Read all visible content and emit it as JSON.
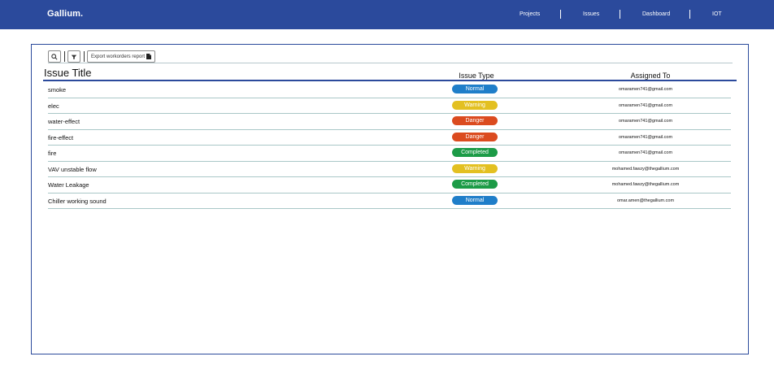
{
  "navbar": {
    "brand": "Gallium.",
    "items": [
      "Projects",
      "Issues",
      "Dashboard",
      "IOT"
    ]
  },
  "toolbar": {
    "export_label": "Export workorders report"
  },
  "table": {
    "headers": {
      "title": "Issue Title",
      "type": "Issue Type",
      "assigned": "Assigned To"
    },
    "rows": [
      {
        "title": "smoke",
        "type": "Normal",
        "assigned": "omaramen741@gmail.com"
      },
      {
        "title": "elec",
        "type": "Warning",
        "assigned": "omaramen741@gmail.com"
      },
      {
        "title": "water-effect",
        "type": "Danger",
        "assigned": "omaramen741@gmail.com"
      },
      {
        "title": "fire-effect",
        "type": "Danger",
        "assigned": "omaramen741@gmail.com"
      },
      {
        "title": "fire",
        "type": "Completed",
        "assigned": "omaramen741@gmail.com"
      },
      {
        "title": "VAV unstable flow",
        "type": "Warning",
        "assigned": "mohamed.fawzy@thegallium.com"
      },
      {
        "title": "Water Leakage",
        "type": "Completed",
        "assigned": "mohamed.fawzy@thegallium.com"
      },
      {
        "title": "Chiller working sound",
        "type": "Normal",
        "assigned": "omar.amen@thegallium.com"
      }
    ]
  },
  "colors": {
    "primary": "#2b4a9c",
    "Normal": "#1f7ec9",
    "Warning": "#e3c021",
    "Danger": "#db4b1f",
    "Completed": "#1c9b47"
  }
}
